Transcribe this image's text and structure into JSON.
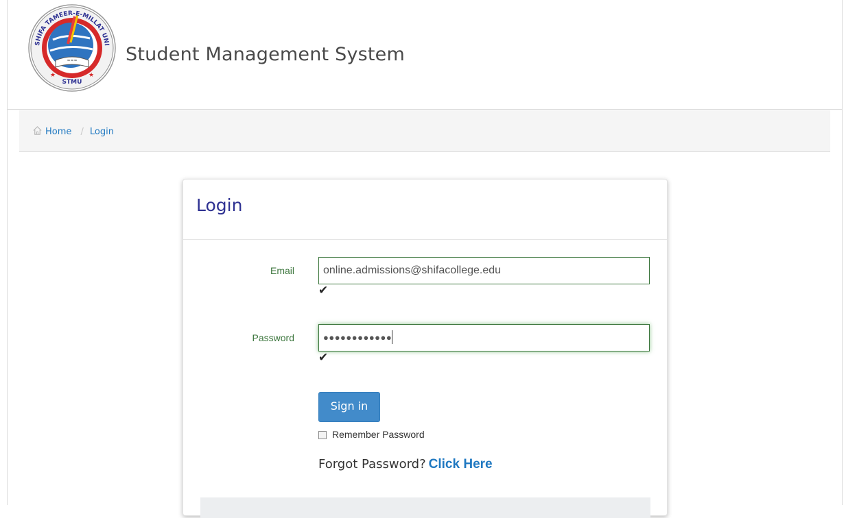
{
  "header": {
    "app_title": "Student Management System",
    "logo": {
      "ring_text": "SHIFA TAMEER-E-MILLAT UNIVERSITY",
      "abbreviation": "STMU",
      "icon": "university-seal"
    }
  },
  "breadcrumb": {
    "home_icon": "home-icon",
    "items": [
      {
        "label": "Home"
      },
      {
        "label": "Login"
      }
    ],
    "separator": "/"
  },
  "login": {
    "title": "Login",
    "email": {
      "label": "Email",
      "value": "online.admissions@shifacollege.edu",
      "valid_icon": "checkmark-icon",
      "valid_glyph": "✔"
    },
    "password": {
      "label": "Password",
      "masked_value": "●●●●●●●●●●●●",
      "valid_icon": "checkmark-icon",
      "valid_glyph": "✔"
    },
    "signin_label": "Sign in",
    "remember_label": "Remember Password",
    "remember_checked": false,
    "forgot_text": "Forgot Password?",
    "forgot_link": "Click Here"
  },
  "colors": {
    "valid_green": "#3c763d",
    "link_blue": "#1f78c1",
    "title_navy": "#2e3192",
    "button_blue": "#428bca"
  }
}
